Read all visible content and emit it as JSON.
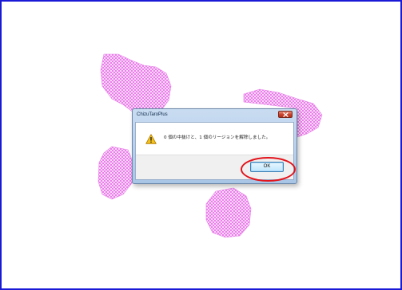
{
  "dialog": {
    "title": "ChizuTaroPlus",
    "message": "0 個の中抜けと、1 個のリージョンを解除しました。",
    "ok_label": "OK"
  },
  "colors": {
    "frame_border": "#1a1ad6",
    "region_fill": "#f08ef0",
    "highlight_ring": "#e3131b"
  },
  "icons": [
    "warning-icon",
    "close-icon"
  ]
}
